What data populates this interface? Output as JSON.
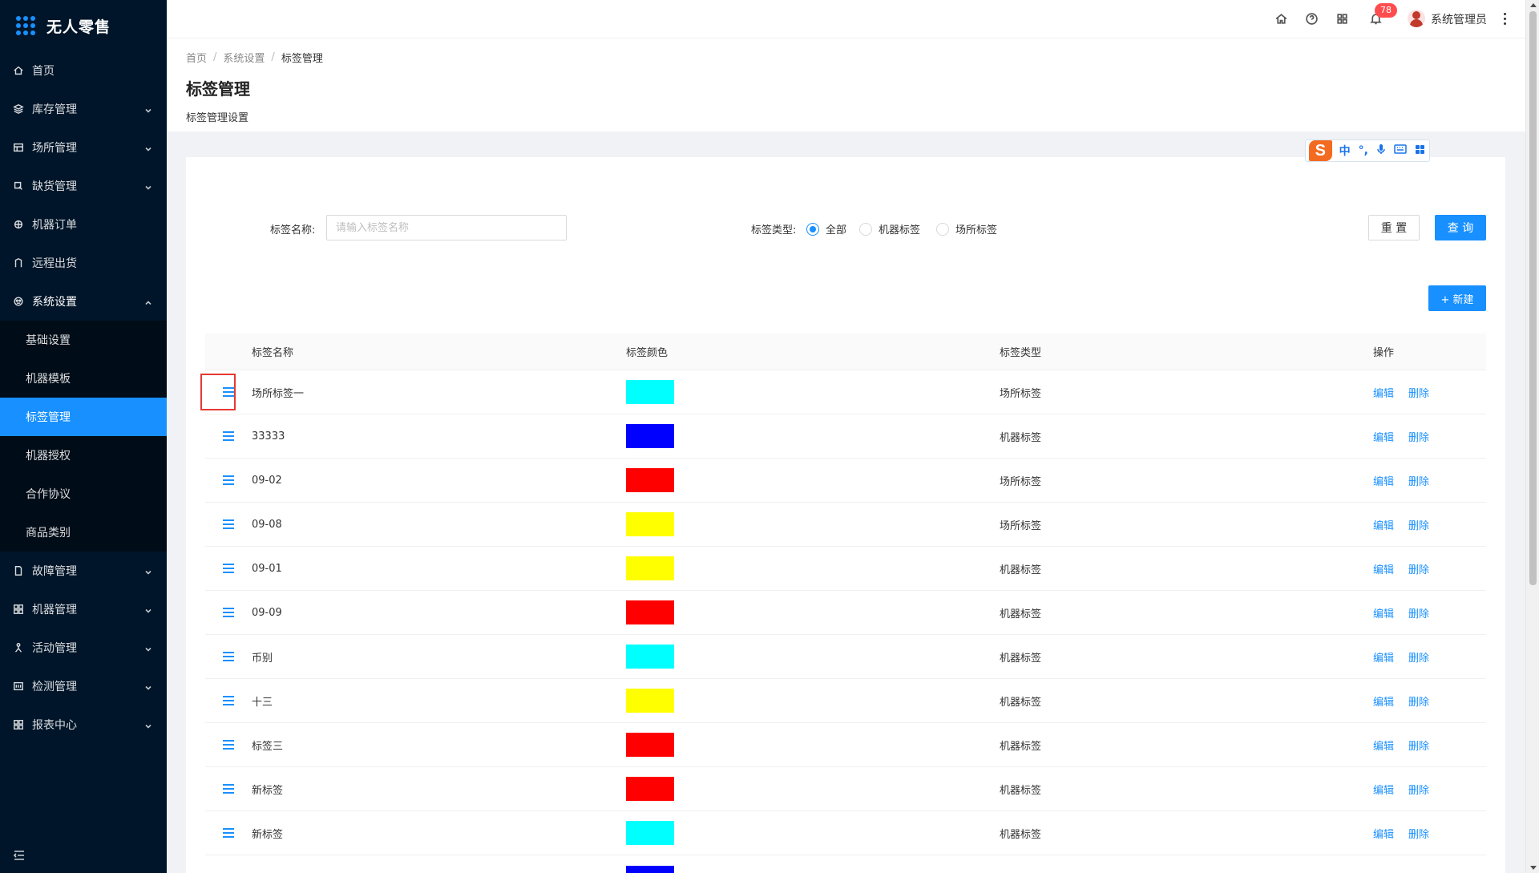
{
  "app": {
    "title": "无人零售"
  },
  "sidebar": {
    "items": [
      {
        "label": "首页",
        "icon": "home-icon",
        "has_children": false
      },
      {
        "label": "库存管理",
        "icon": "inventory-icon",
        "has_children": true
      },
      {
        "label": "场所管理",
        "icon": "venue-icon",
        "has_children": true
      },
      {
        "label": "缺货管理",
        "icon": "shortage-icon",
        "has_children": true
      },
      {
        "label": "机器订单",
        "icon": "order-icon",
        "has_children": false
      },
      {
        "label": "远程出货",
        "icon": "remote-ship-icon",
        "has_children": false
      },
      {
        "label": "系统设置",
        "icon": "settings-icon",
        "has_children": true,
        "open": true
      },
      {
        "label": "故障管理",
        "icon": "fault-icon",
        "has_children": true
      },
      {
        "label": "机器管理",
        "icon": "machine-icon",
        "has_children": true
      },
      {
        "label": "活动管理",
        "icon": "activity-icon",
        "has_children": true
      },
      {
        "label": "检测管理",
        "icon": "detect-icon",
        "has_children": true
      },
      {
        "label": "报表中心",
        "icon": "report-icon",
        "has_children": true
      }
    ],
    "system_submenu": [
      {
        "label": "基础设置"
      },
      {
        "label": "机器模板"
      },
      {
        "label": "标签管理",
        "active": true
      },
      {
        "label": "机器授权"
      },
      {
        "label": "合作协议"
      },
      {
        "label": "商品类别"
      }
    ]
  },
  "header": {
    "notification_count": "78",
    "username": "系统管理员"
  },
  "page": {
    "breadcrumb": [
      "首页",
      "系统设置",
      "标签管理"
    ],
    "title": "标签管理",
    "description": "标签管理设置"
  },
  "ime": {
    "logo": "S",
    "items": [
      "中",
      "°,"
    ]
  },
  "search": {
    "name_label": "标签名称:",
    "name_placeholder": "请输入标签名称",
    "type_label": "标签类型:",
    "type_options": [
      "全部",
      "机器标签",
      "场所标签"
    ],
    "type_selected": "全部",
    "reset_label": "重 置",
    "query_label": "查 询"
  },
  "new_button": "+ 新建",
  "table": {
    "columns": [
      "标签名称",
      "标签颜色",
      "标签类型",
      "操作"
    ],
    "actions": {
      "edit": "编辑",
      "delete": "删除"
    },
    "rows": [
      {
        "name": "场所标签一",
        "color": "#00ffff",
        "type": "场所标签"
      },
      {
        "name": "33333",
        "color": "#0000ff",
        "type": "机器标签"
      },
      {
        "name": "09-02",
        "color": "#ff0000",
        "type": "场所标签"
      },
      {
        "name": "09-08",
        "color": "#ffff00",
        "type": "场所标签"
      },
      {
        "name": "09-01",
        "color": "#ffff00",
        "type": "机器标签"
      },
      {
        "name": "09-09",
        "color": "#ff0000",
        "type": "机器标签"
      },
      {
        "name": "币别",
        "color": "#00ffff",
        "type": "机器标签"
      },
      {
        "name": "十三",
        "color": "#ffff00",
        "type": "机器标签"
      },
      {
        "name": "标签三",
        "color": "#ff0000",
        "type": "机器标签"
      },
      {
        "name": "新标签",
        "color": "#ff0000",
        "type": "机器标签"
      },
      {
        "name": "新标签",
        "color": "#00ffff",
        "type": "机器标签"
      },
      {
        "name": "",
        "color": "#0000ff",
        "type": ""
      }
    ]
  },
  "colors": {
    "accent": "#1890ff",
    "sidebar_bg": "#001529",
    "badge": "#ff4d4f"
  }
}
